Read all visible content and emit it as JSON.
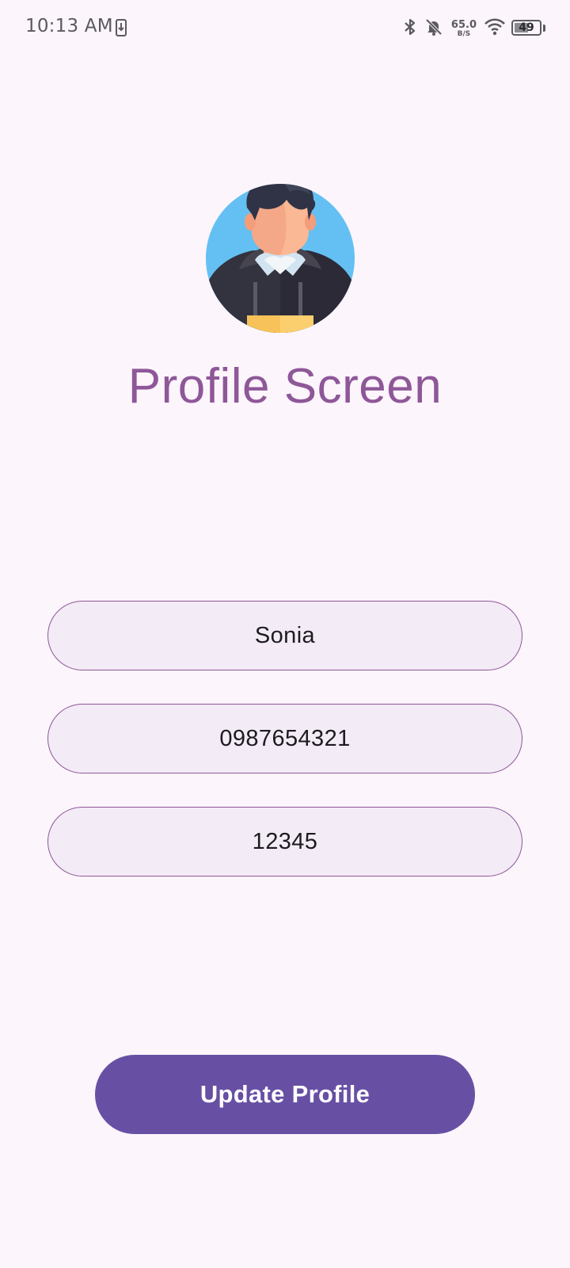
{
  "status_bar": {
    "time": "10:13 AM",
    "net_speed_value": "65.0",
    "net_speed_unit": "B/S",
    "battery_level": "49",
    "icons": [
      "download-icon",
      "bluetooth-icon",
      "bell-off-icon",
      "wifi-icon",
      "battery-icon"
    ]
  },
  "profile": {
    "avatar_icon": "user-avatar",
    "title": "Profile Screen"
  },
  "form": {
    "name_value": "Sonia",
    "phone_value": "0987654321",
    "code_value": "12345"
  },
  "actions": {
    "update_label": "Update Profile"
  },
  "colors": {
    "background": "#fcf5fc",
    "title": "#8e5798",
    "field_border": "#8e5798",
    "field_fill": "#f3ebf6",
    "button": "#6750a4",
    "button_text": "#ffffff"
  }
}
